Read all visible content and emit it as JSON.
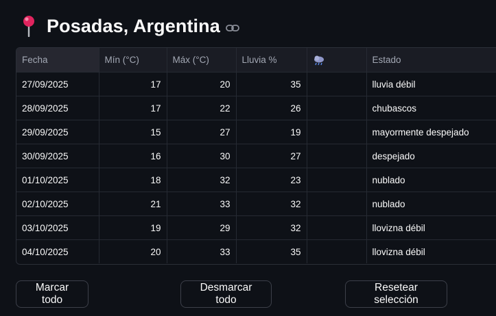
{
  "header": {
    "title": "Posadas, Argentina",
    "pin_icon": "round-pushpin-icon",
    "link_icon": "link-icon"
  },
  "table": {
    "columns": [
      "Fecha",
      "Mín (°C)",
      "Máx (°C)",
      "Lluvia %",
      "",
      "Estado"
    ],
    "icon_column": "cloud-rain-icon",
    "rows": [
      {
        "fecha": "27/09/2025",
        "min": "17",
        "max": "20",
        "lluvia": "35",
        "estado": "lluvia débil"
      },
      {
        "fecha": "28/09/2025",
        "min": "17",
        "max": "22",
        "lluvia": "26",
        "estado": "chubascos"
      },
      {
        "fecha": "29/09/2025",
        "min": "15",
        "max": "27",
        "lluvia": "19",
        "estado": "mayormente despejado"
      },
      {
        "fecha": "30/09/2025",
        "min": "16",
        "max": "30",
        "lluvia": "27",
        "estado": "despejado"
      },
      {
        "fecha": "01/10/2025",
        "min": "18",
        "max": "32",
        "lluvia": "23",
        "estado": "nublado"
      },
      {
        "fecha": "02/10/2025",
        "min": "21",
        "max": "33",
        "lluvia": "32",
        "estado": "nublado"
      },
      {
        "fecha": "03/10/2025",
        "min": "19",
        "max": "29",
        "lluvia": "32",
        "estado": "llovizna débil"
      },
      {
        "fecha": "04/10/2025",
        "min": "20",
        "max": "33",
        "lluvia": "35",
        "estado": "llovizna débil"
      }
    ]
  },
  "buttons": {
    "mark_all": "Marcar todo",
    "unmark_all": "Desmarcar todo",
    "reset_selection": "Resetear selección"
  },
  "colors": {
    "background": "#0e1117",
    "header_bg": "#1a1c24",
    "border": "#262a33",
    "text": "#fafafa",
    "muted_text": "#a3a8b4"
  }
}
